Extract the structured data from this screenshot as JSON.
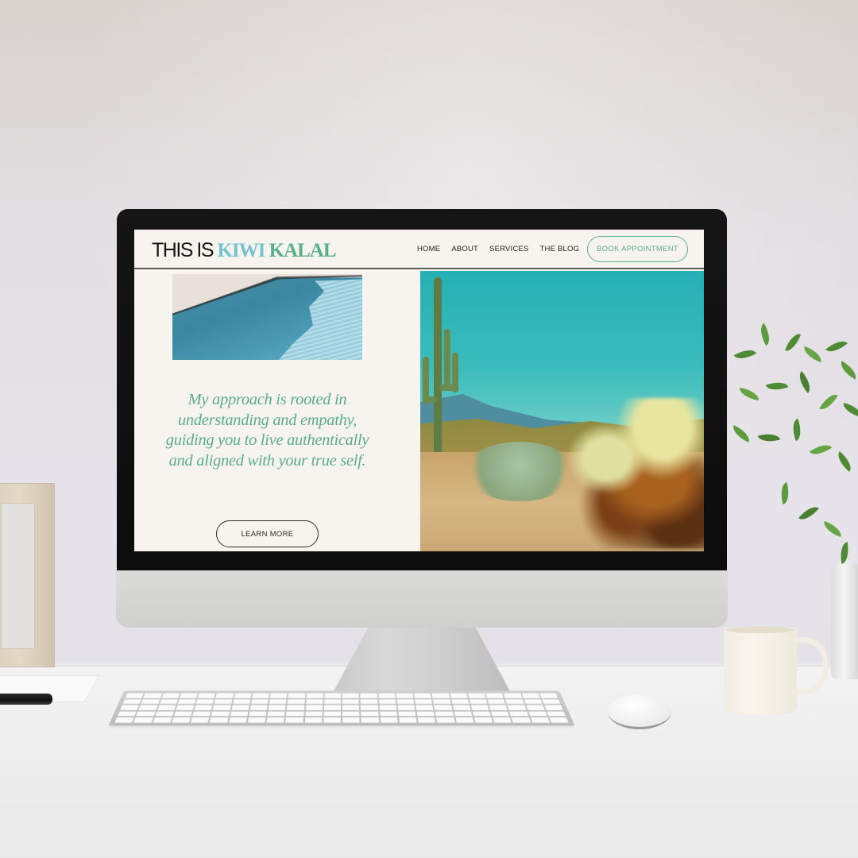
{
  "website": {
    "logo": {
      "part1": "THIS IS ",
      "part2": "KIWI",
      "part3": " KALAL"
    },
    "nav": {
      "items": [
        {
          "label": "HOME"
        },
        {
          "label": "ABOUT"
        },
        {
          "label": "SERVICES"
        },
        {
          "label": "THE BLOG"
        }
      ],
      "cta_label": "BOOK APPOINTMENT"
    },
    "hero": {
      "quote": "My approach is rooted in understanding and empathy, guiding you to live authentically and aligned with your true self.",
      "button_label": "LEARN MORE",
      "left_image": "pool-photo",
      "right_image": "desert-cactus-photo"
    },
    "colors": {
      "background": "#f7f3ee",
      "logo_dark": "#161616",
      "logo_blue": "#74c3cf",
      "accent_green": "#5aae88",
      "nav_text": "#1f1f1f"
    }
  },
  "scene": {
    "objects": [
      "imac-monitor",
      "keyboard",
      "mouse",
      "coffee-mug",
      "potted-plant",
      "photo-frame",
      "pen",
      "paper"
    ]
  }
}
